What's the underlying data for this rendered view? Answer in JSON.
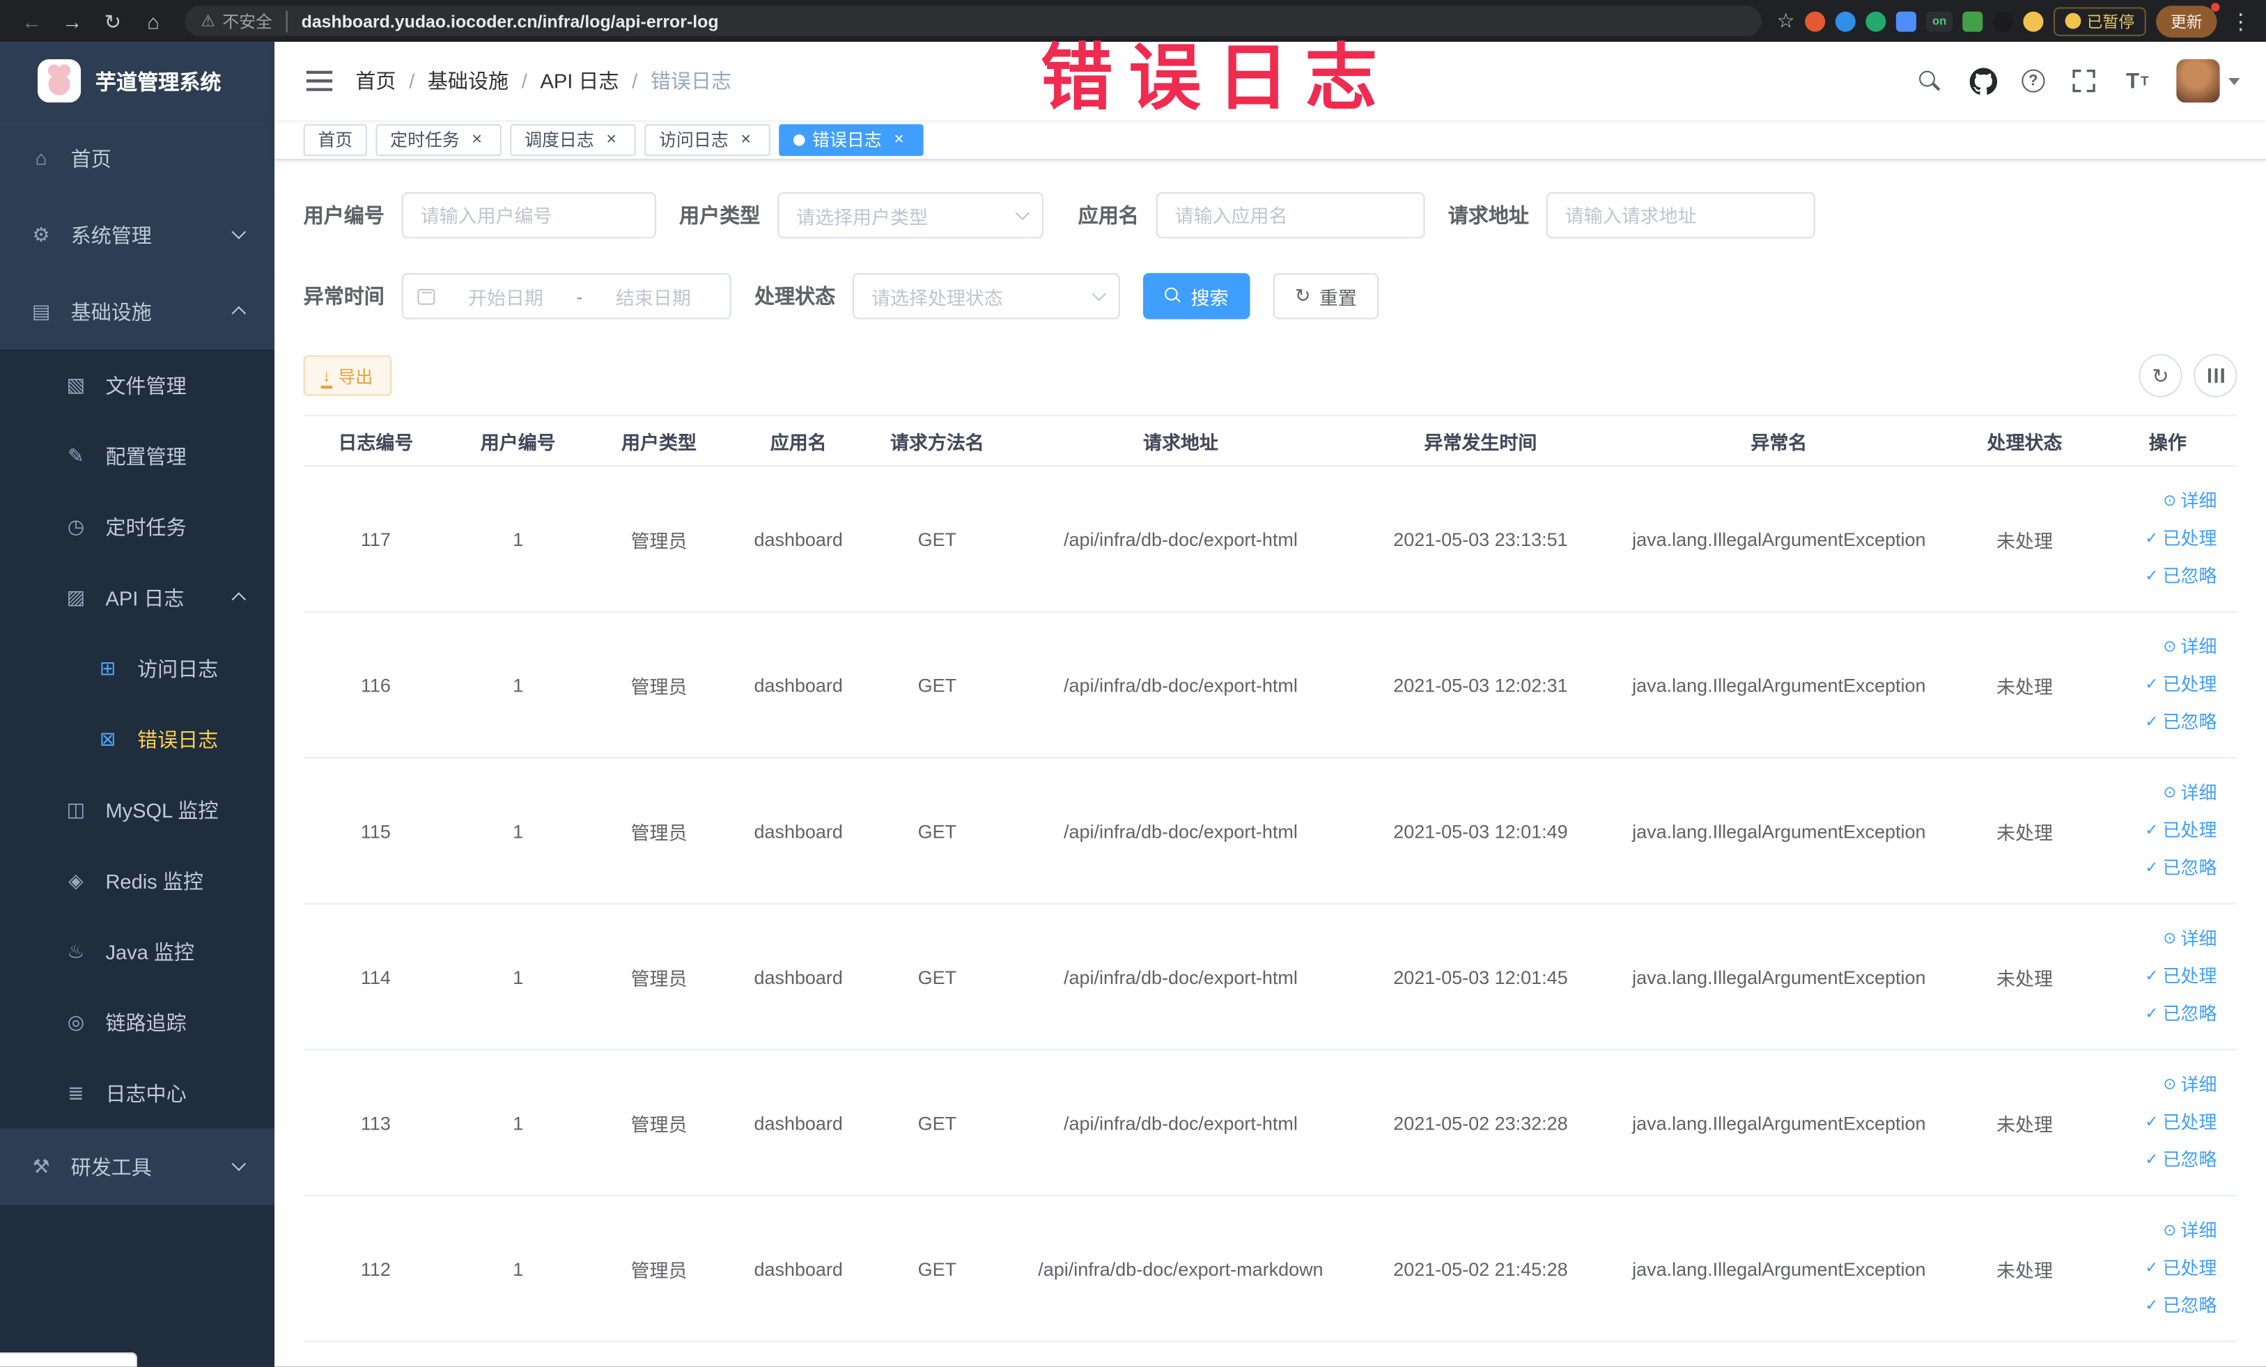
{
  "browser": {
    "security_label": "不安全",
    "url": "dashboard.yudao.iocoder.cn/infra/log/api-error-log",
    "extensions_on_badge": "on",
    "paused_badge": "已暂停",
    "update_button": "更新"
  },
  "annotation": {
    "text": "错误日志"
  },
  "sidebar": {
    "logo_title": "芋道管理系统",
    "menu": [
      {
        "label": "首页",
        "icon": "home-icon",
        "glyph": "⌂",
        "level": 1
      },
      {
        "label": "系统管理",
        "icon": "gear-icon",
        "glyph": "⚙",
        "level": 1,
        "arrow": "down"
      },
      {
        "label": "基础设施",
        "icon": "infrastructure-icon",
        "glyph": "▤",
        "level": 1,
        "arrow": "up"
      },
      {
        "label": "文件管理",
        "icon": "file-manage-icon",
        "glyph": "▧",
        "level": 2
      },
      {
        "label": "配置管理",
        "icon": "config-manage-icon",
        "glyph": "✎",
        "level": 2
      },
      {
        "label": "定时任务",
        "icon": "timer-job-icon",
        "glyph": "◷",
        "level": 2
      },
      {
        "label": "API 日志",
        "icon": "api-log-icon",
        "glyph": "▨",
        "level": 2,
        "arrow": "up"
      },
      {
        "label": "访问日志",
        "icon": "access-log-icon",
        "glyph": "⊞",
        "level": 3
      },
      {
        "label": "错误日志",
        "icon": "error-log-icon",
        "glyph": "⊠",
        "level": 3,
        "active": true
      },
      {
        "label": "MySQL 监控",
        "icon": "mysql-monitor-icon",
        "glyph": "◫",
        "level": 2
      },
      {
        "label": "Redis 监控",
        "icon": "redis-monitor-icon",
        "glyph": "◈",
        "level": 2
      },
      {
        "label": "Java 监控",
        "icon": "java-monitor-icon",
        "glyph": "♨",
        "level": 2
      },
      {
        "label": "链路追踪",
        "icon": "trace-icon",
        "glyph": "◎",
        "level": 2
      },
      {
        "label": "日志中心",
        "icon": "log-center-icon",
        "glyph": "≣",
        "level": 2
      },
      {
        "label": "研发工具",
        "icon": "devtools-icon",
        "glyph": "⚒",
        "level": 1,
        "arrow": "down"
      }
    ]
  },
  "header": {
    "breadcrumb": [
      "首页",
      "基础设施",
      "API 日志",
      "错误日志"
    ],
    "breadcrumb_separator": "/"
  },
  "tabs": [
    {
      "label": "首页",
      "closable": false
    },
    {
      "label": "定时任务",
      "closable": true
    },
    {
      "label": "调度日志",
      "closable": true
    },
    {
      "label": "访问日志",
      "closable": true
    },
    {
      "label": "错误日志",
      "closable": true,
      "active": true
    }
  ],
  "filters": {
    "user_id": {
      "label": "用户编号",
      "placeholder": "请输入用户编号"
    },
    "user_type": {
      "label": "用户类型",
      "placeholder": "请选择用户类型"
    },
    "app_name": {
      "label": "应用名",
      "placeholder": "请输入应用名"
    },
    "request_url": {
      "label": "请求地址",
      "placeholder": "请输入请求地址"
    },
    "exception_time": {
      "label": "异常时间",
      "start_placeholder": "开始日期",
      "separator": "-",
      "end_placeholder": "结束日期"
    },
    "process_status": {
      "label": "处理状态",
      "placeholder": "请选择处理状态"
    },
    "search_button": "搜索",
    "reset_button": "重置"
  },
  "toolbar": {
    "export_button": "导出"
  },
  "table": {
    "columns": [
      {
        "label": "日志编号",
        "col": "id"
      },
      {
        "label": "用户编号",
        "col": "uid"
      },
      {
        "label": "用户类型",
        "col": "utype"
      },
      {
        "label": "应用名",
        "col": "app"
      },
      {
        "label": "请求方法名",
        "col": "method"
      },
      {
        "label": "请求地址",
        "col": "url"
      },
      {
        "label": "异常发生时间",
        "col": "time"
      },
      {
        "label": "异常名",
        "col": "exc"
      },
      {
        "label": "处理状态",
        "col": "status"
      },
      {
        "label": "操作",
        "col": "ops"
      }
    ],
    "actions": [
      "详细",
      "已处理",
      "已忽略"
    ],
    "action_glyphs": [
      "⊙",
      "✓",
      "✓"
    ],
    "rows": [
      {
        "id": "117",
        "user_id": "1",
        "user_type": "管理员",
        "app": "dashboard",
        "method": "GET",
        "url": "/api/infra/db-doc/export-html",
        "time": "2021-05-03 23:13:51",
        "exception": "java.lang.IllegalArgumentException",
        "status": "未处理"
      },
      {
        "id": "116",
        "user_id": "1",
        "user_type": "管理员",
        "app": "dashboard",
        "method": "GET",
        "url": "/api/infra/db-doc/export-html",
        "time": "2021-05-03 12:02:31",
        "exception": "java.lang.IllegalArgumentException",
        "status": "未处理"
      },
      {
        "id": "115",
        "user_id": "1",
        "user_type": "管理员",
        "app": "dashboard",
        "method": "GET",
        "url": "/api/infra/db-doc/export-html",
        "time": "2021-05-03 12:01:49",
        "exception": "java.lang.IllegalArgumentException",
        "status": "未处理"
      },
      {
        "id": "114",
        "user_id": "1",
        "user_type": "管理员",
        "app": "dashboard",
        "method": "GET",
        "url": "/api/infra/db-doc/export-html",
        "time": "2021-05-03 12:01:45",
        "exception": "java.lang.IllegalArgumentException",
        "status": "未处理"
      },
      {
        "id": "113",
        "user_id": "1",
        "user_type": "管理员",
        "app": "dashboard",
        "method": "GET",
        "url": "/api/infra/db-doc/export-html",
        "time": "2021-05-02 23:32:28",
        "exception": "java.lang.IllegalArgumentException",
        "status": "未处理"
      },
      {
        "id": "112",
        "user_id": "1",
        "user_type": "管理员",
        "app": "dashboard",
        "method": "GET",
        "url": "/api/infra/db-doc/export-markdown",
        "time": "2021-05-02 21:45:28",
        "exception": "java.lang.IllegalArgumentException",
        "status": "未处理"
      }
    ]
  },
  "colors": {
    "primary": "#409eff",
    "sidebar_bg": "#2d3d53",
    "submenu_bg": "#1f2d3d",
    "menu_active_text": "#ffd04b",
    "warning": "#e6a23c",
    "annotation_red": "#ef2b50"
  }
}
